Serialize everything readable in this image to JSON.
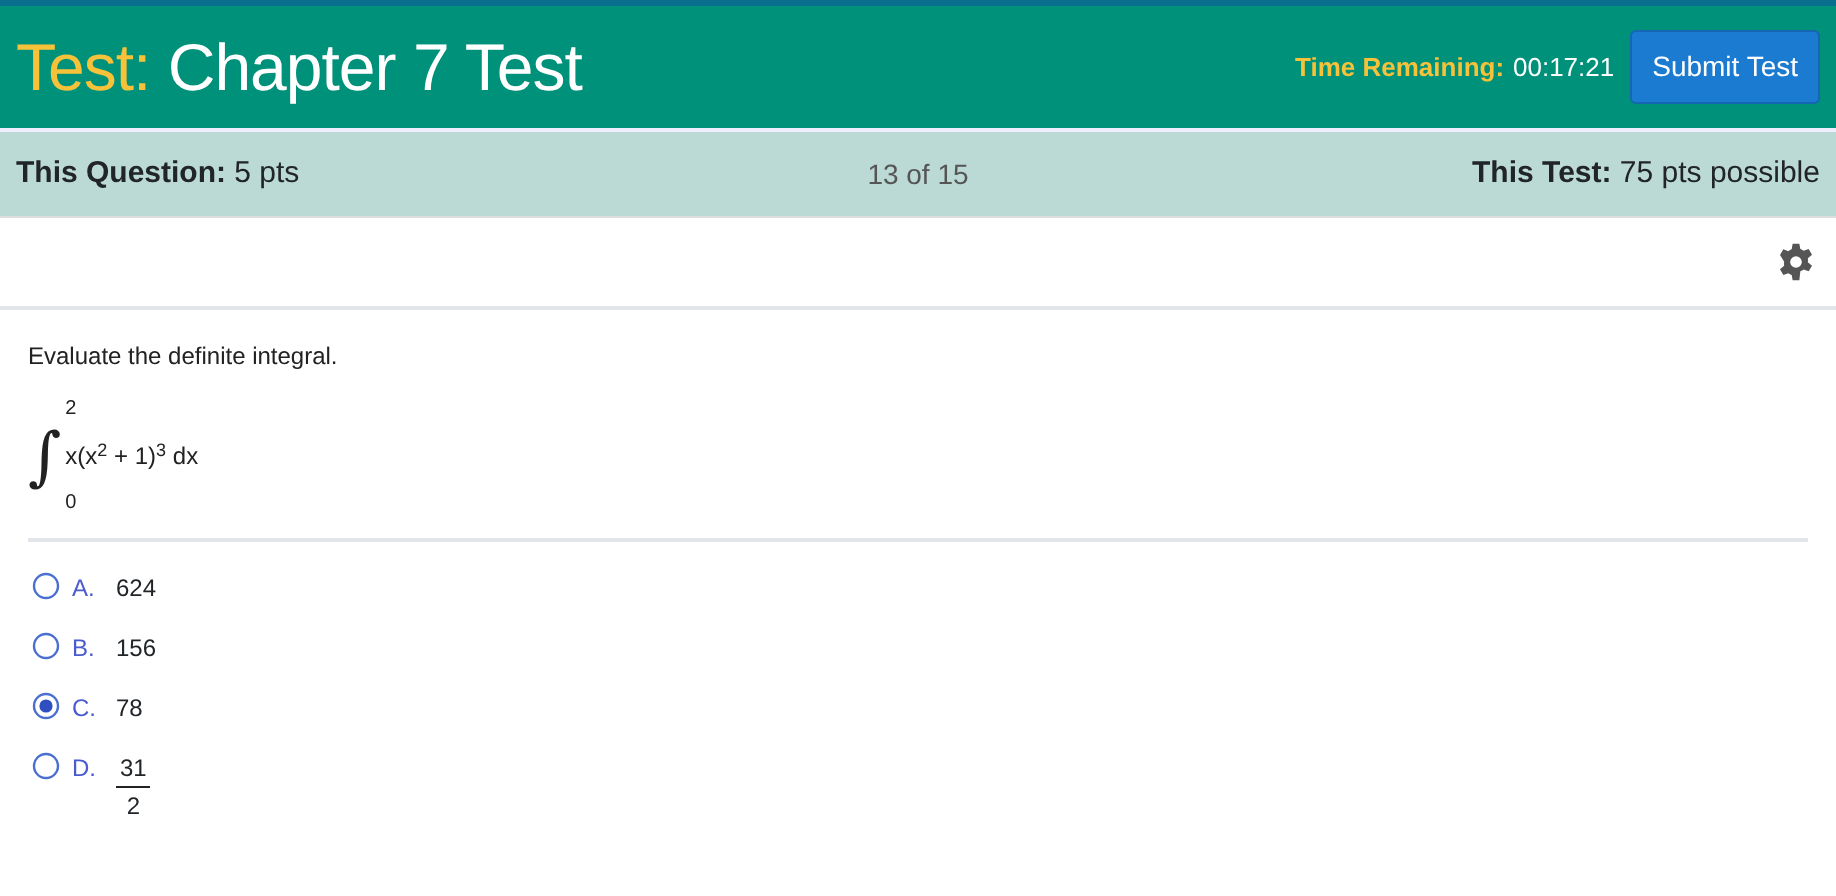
{
  "header": {
    "title_label": "Test:",
    "title": "Chapter 7 Test",
    "time_label": "Time Remaining:",
    "time_value": "00:17:21",
    "submit_button": "Submit Test"
  },
  "info_bar": {
    "question_label": "This Question:",
    "question_points": "5 pts",
    "progress": "13 of 15",
    "test_label": "This Test:",
    "test_points": "75 pts possible"
  },
  "question": {
    "prompt": "Evaluate the definite integral.",
    "integral": {
      "sign": "∫",
      "upper": "2",
      "lower": "0",
      "expression": "x(x$^{2}$ + 1)$^{3}$ dx"
    }
  },
  "options": [
    {
      "letter": "A.",
      "kind": "number",
      "value": "624",
      "selected": false
    },
    {
      "letter": "B.",
      "kind": "number",
      "value": "156",
      "selected": false
    },
    {
      "letter": "C.",
      "kind": "number",
      "value": "78",
      "selected": true
    },
    {
      "letter": "D.",
      "kind": "fraction",
      "numerator": "31",
      "denominator": "2",
      "selected": false
    }
  ]
}
